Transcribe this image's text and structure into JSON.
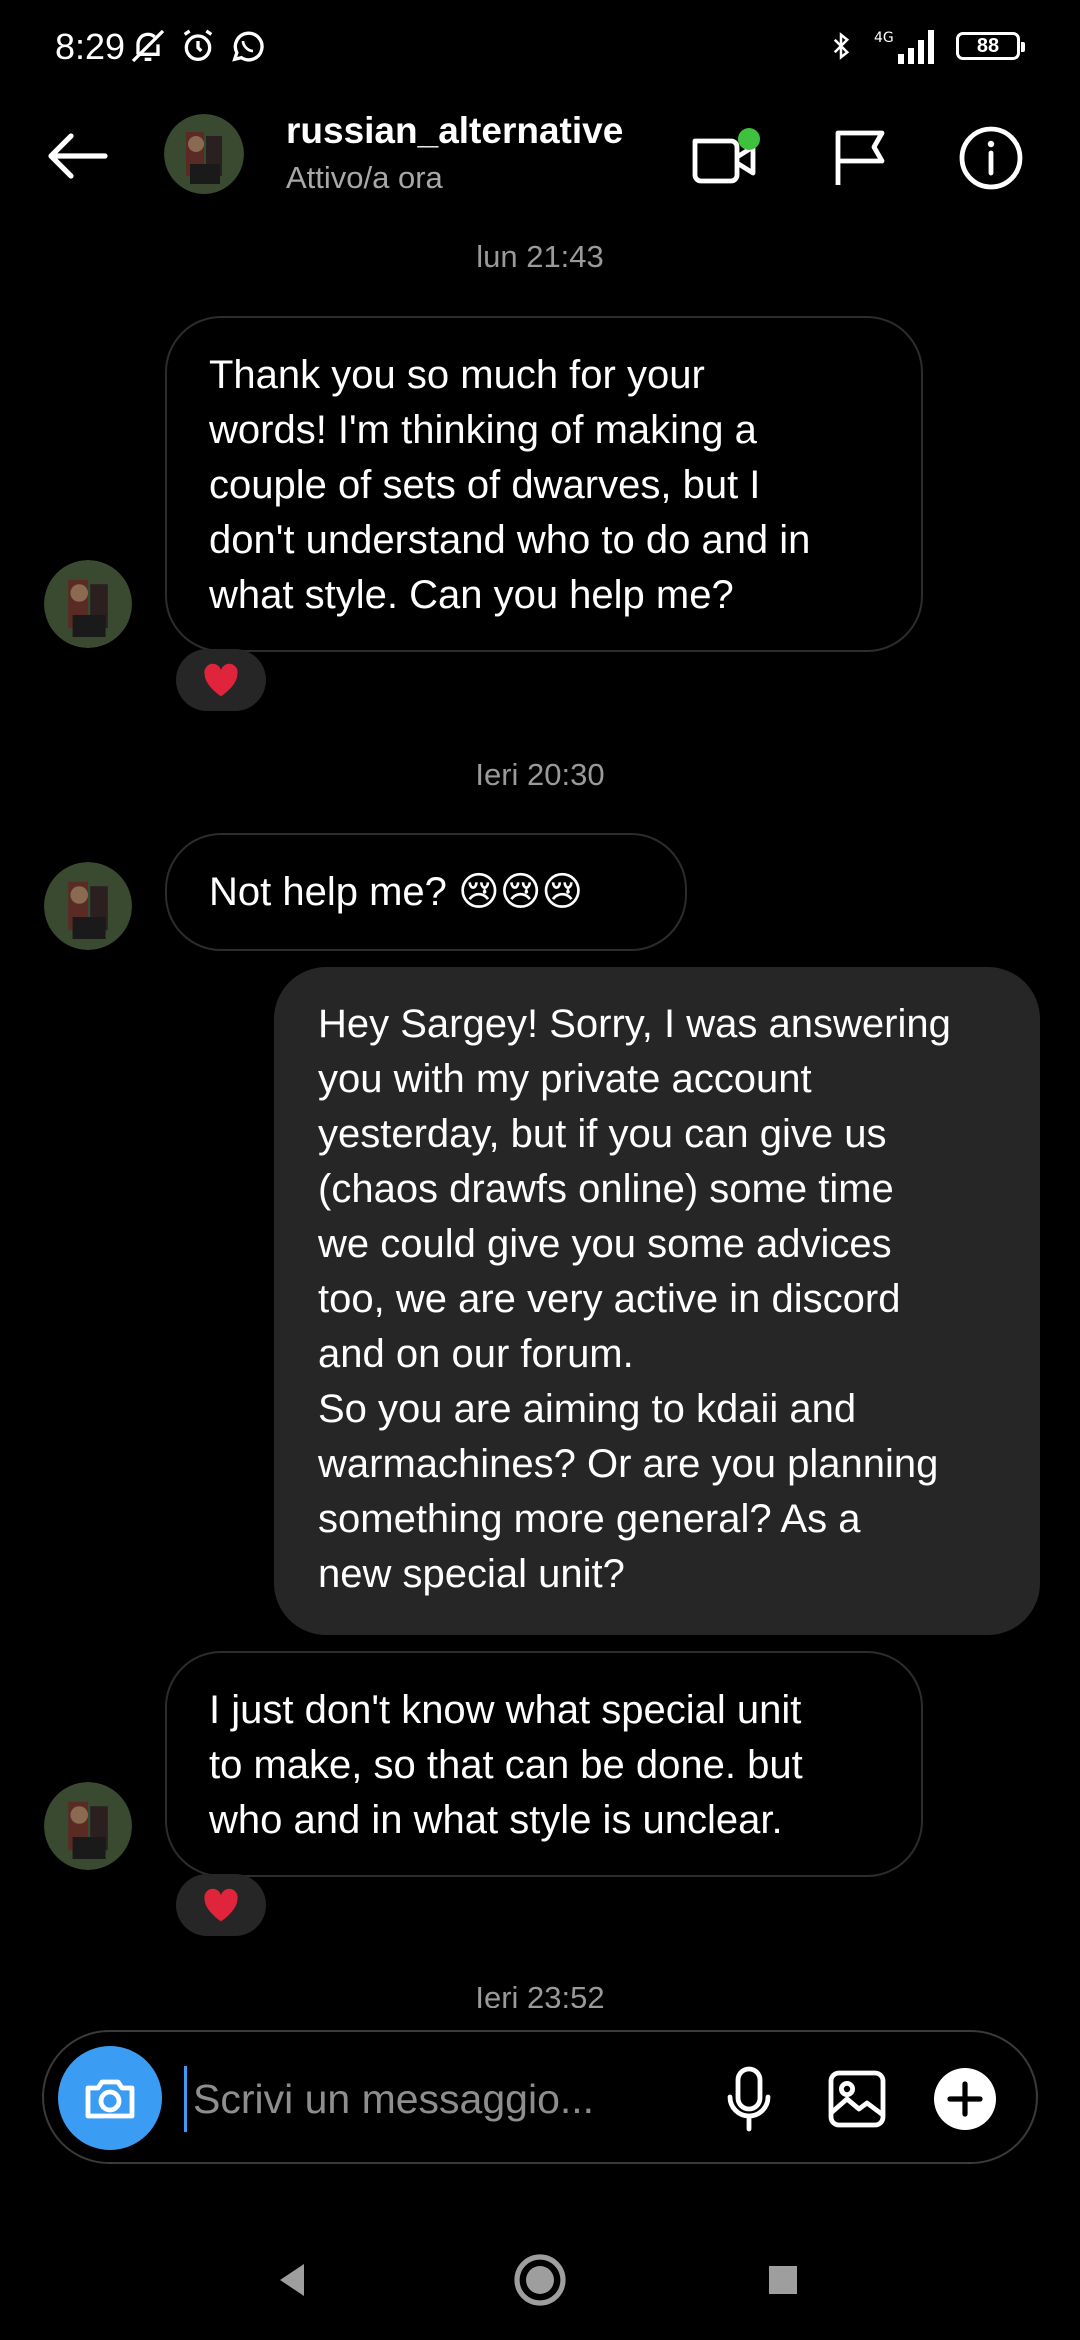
{
  "status_bar": {
    "time": "8:29",
    "network": "4G",
    "battery": "88"
  },
  "header": {
    "username": "russian_alternative",
    "status": "Attivo/a ora"
  },
  "messages": {
    "ts1": "lun 21:43",
    "m1_lines": [
      "Thank you so much for your",
      "words! I'm thinking of making a",
      "couple of sets of dwarves, but I",
      "don't understand who to do and in",
      "what style. Can you help me?"
    ],
    "ts2": "Ieri 20:30",
    "m2": "Not help me? 😢😢😢",
    "m3_lines": [
      "Hey Sargey! Sorry, I was answering",
      "you with my private account",
      "yesterday, but if you can give us",
      "(chaos drawfs online) some time",
      "we could give you some advices",
      "too, we are very active in discord",
      "and on our forum.",
      "So you are aiming to kdaii and",
      "warmachines? Or are you planning",
      "something more general? As a",
      "new special unit?"
    ],
    "m4_lines": [
      "I just don't know what special unit",
      "to make, so that can be done.  but",
      "who and in what style is unclear."
    ],
    "ts3": "Ieri 23:52",
    "reaction": "❤️"
  },
  "composer": {
    "placeholder": "Scrivi un messaggio..."
  },
  "colors": {
    "accent": "#3b9cf4",
    "online": "#3ec23e",
    "bubble_out": "#262626",
    "bubble_in_border": "#2c2c2c",
    "reaction_heart": "#e0243c"
  }
}
